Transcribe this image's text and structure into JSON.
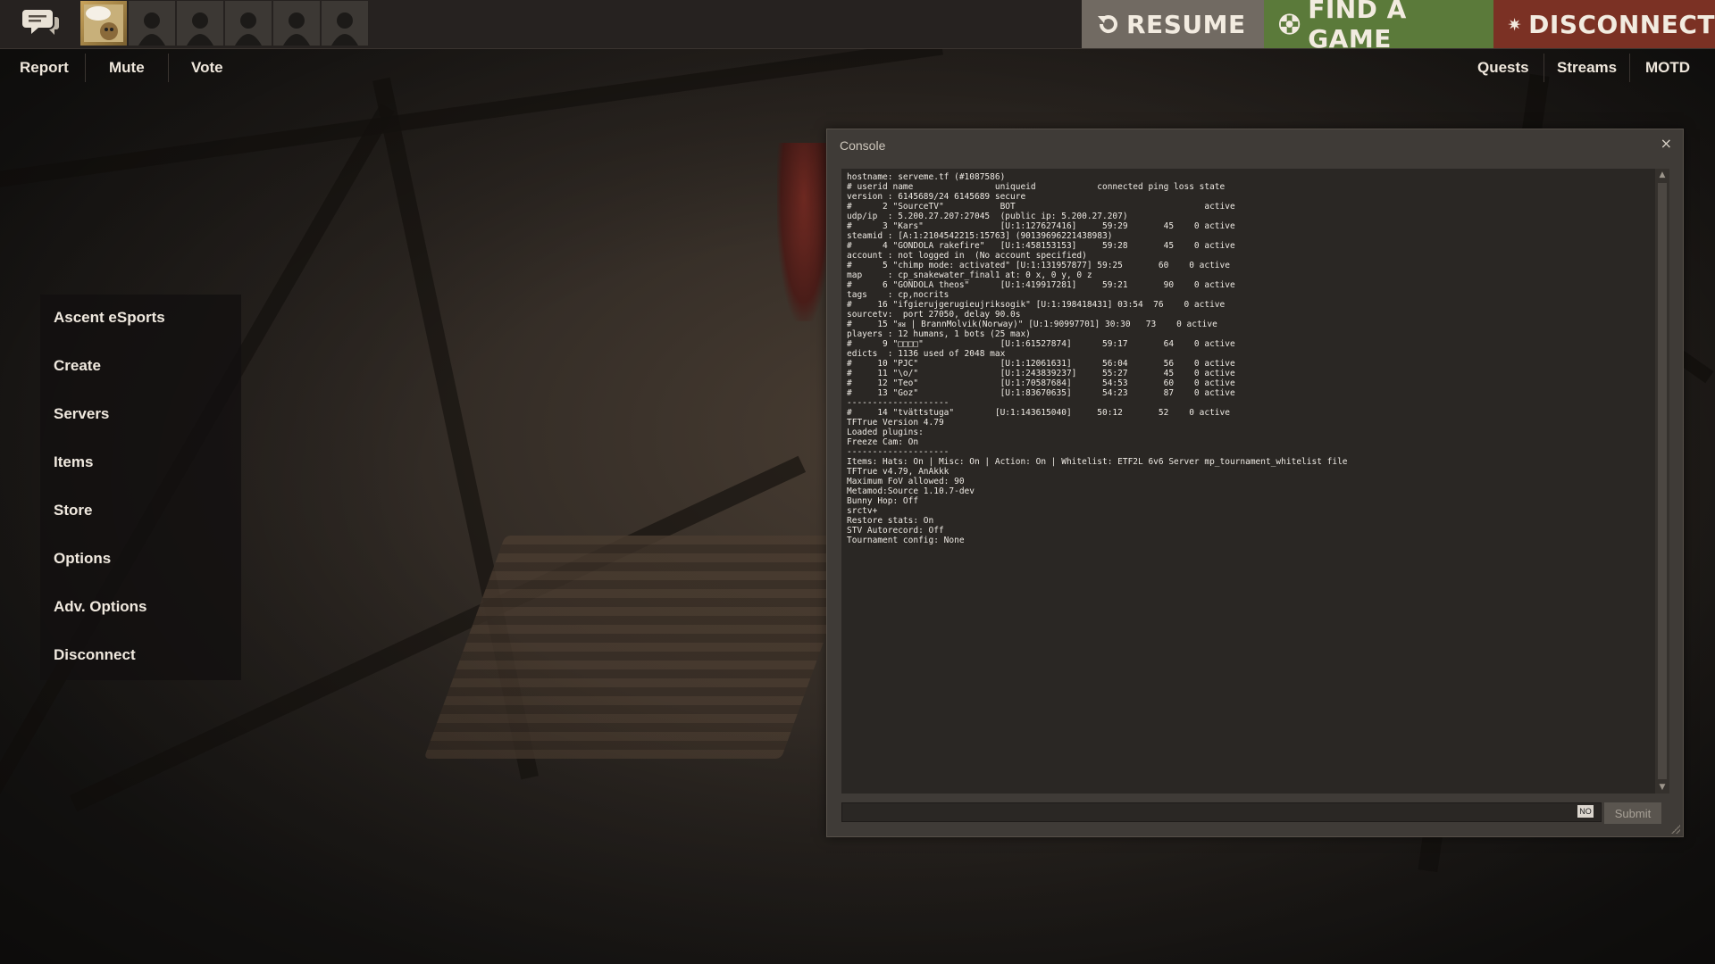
{
  "topbar": {
    "chat_icon": "speech-bubbles-icon",
    "avatars": [
      {
        "name": "player-avatar",
        "kind": "custom"
      },
      {
        "name": "empty-slot",
        "kind": "silhouette"
      },
      {
        "name": "empty-slot",
        "kind": "silhouette"
      },
      {
        "name": "empty-slot",
        "kind": "silhouette"
      },
      {
        "name": "empty-slot",
        "kind": "silhouette"
      },
      {
        "name": "empty-slot",
        "kind": "silhouette"
      }
    ],
    "resume_label": "RESUME",
    "find_game_label": "FIND A GAME",
    "disconnect_label": "DISCONNECT",
    "colors": {
      "resume": "#716a62",
      "find_game": "#5b7a3a",
      "disconnect": "#7b3124"
    }
  },
  "subbar": {
    "left": [
      "Report",
      "Mute",
      "Vote"
    ],
    "right": [
      "Quests",
      "Streams",
      "MOTD"
    ]
  },
  "menu": {
    "items": [
      "Ascent eSports",
      "Create",
      "Servers",
      "Items",
      "Store",
      "Options",
      "Adv. Options",
      "Disconnect"
    ]
  },
  "console": {
    "title": "Console",
    "close": "×",
    "lines": [
      "hostname: serveme.tf (#1087586)",
      "# userid name                uniqueid            connected ping loss state",
      "version : 6145689/24 6145689 secure",
      "#      2 \"SourceTV\"           BOT                                     active",
      "udp/ip  : 5.200.27.207:27045  (public ip: 5.200.27.207)",
      "#      3 \"Kars\"               [U:1:127627416]     59:29       45    0 active",
      "steamid : [A:1:2104542215:15763] (90139696221438983)",
      "#      4 \"GONDOLA rakefire\"   [U:1:458153153]     59:28       45    0 active",
      "account : not logged in  (No account specified)",
      "#      5 \"chimp mode: activated\" [U:1:131957877] 59:25       60    0 active",
      "map     : cp_snakewater_final1 at: 0 x, 0 y, 0 z",
      "#      6 \"GONDOLA theos\"      [U:1:419917281]     59:21       90    0 active",
      "tags    : cp,nocrits",
      "#     16 \"ifgierujgerugieujriksogik\" [U:1:198418431] 03:54  76    0 active",
      "sourcetv:  port 27050, delay 90.0s",
      "#     15 \"ᴙᴚ | BrannMolvik(Norway)\" [U:1:90997701] 30:30   73    0 active",
      "players : 12 humans, 1 bots (25 max)",
      "#      9 \"□□□□\"               [U:1:61527874]      59:17       64    0 active",
      "edicts  : 1136 used of 2048 max",
      "#     10 \"PJC\"                [U:1:12061631]      56:04       56    0 active",
      "#     11 \"\\o/\"                [U:1:243839237]     55:27       45    0 active",
      "#     12 \"Teo\"                [U:1:70587684]      54:53       60    0 active",
      "#     13 \"Goz\"                [U:1:83670635]      54:23       87    0 active",
      "--------------------",
      "#     14 \"tvättstuga\"        [U:1:143615040]     50:12       52    0 active",
      "TFTrue Version 4.79",
      "Loaded plugins:",
      "Freeze Cam: On",
      "--------------------",
      "Items: Hats: On | Misc: On | Action: On | Whitelist: ETF2L 6v6 Server mp_tournament_whitelist file",
      "TFTrue v4.79, AnAkkk",
      "Maximum FoV allowed: 90",
      "Metamod:Source 1.10.7-dev",
      "Bunny Hop: Off",
      "srctv+",
      "Restore stats: On",
      "STV Autorecord: Off",
      "Tournament config: None"
    ],
    "input_value": "",
    "ime_badge": "NO",
    "submit_label": "Submit"
  }
}
